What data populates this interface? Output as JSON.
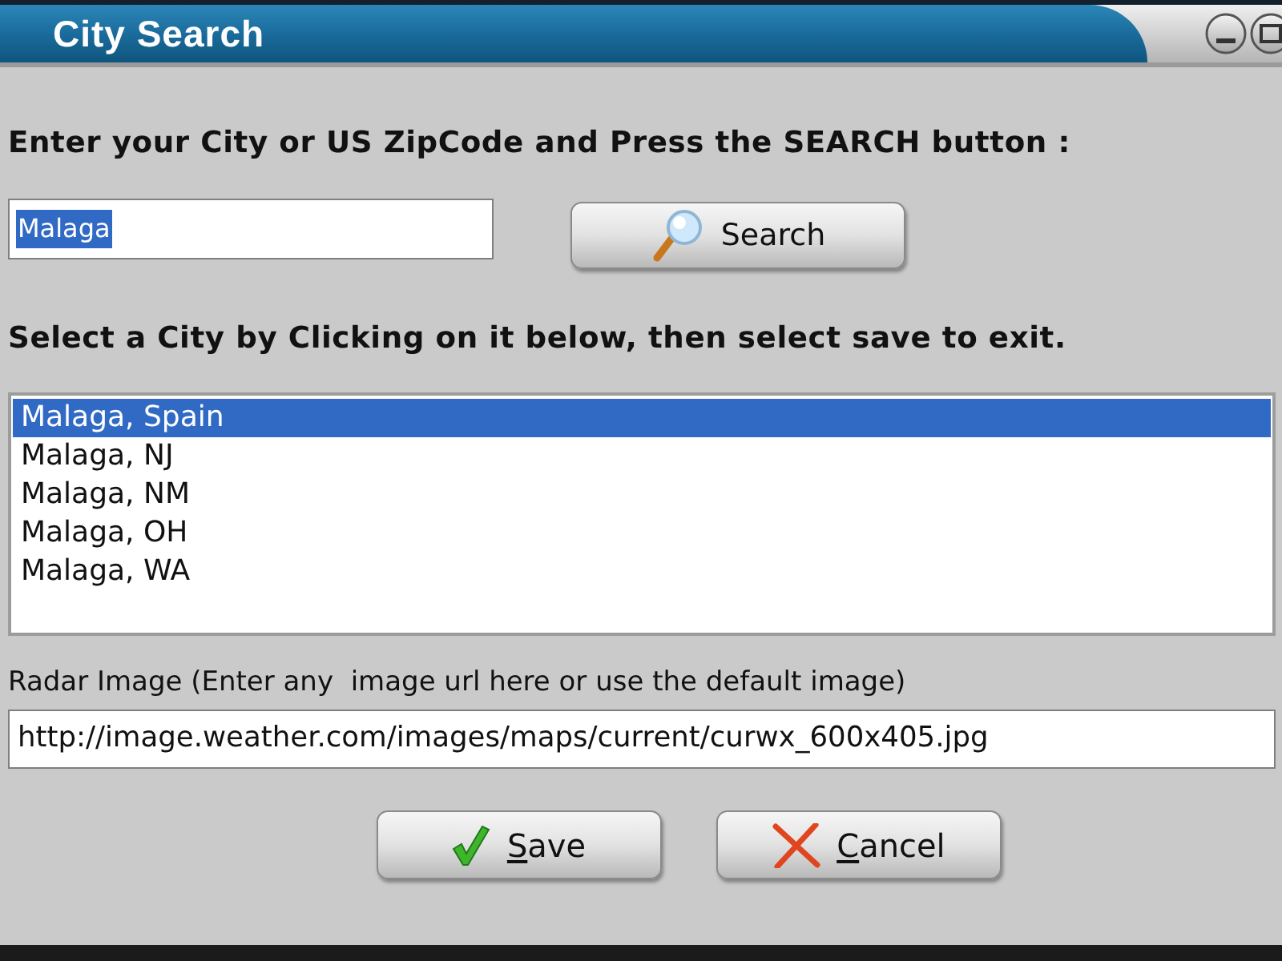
{
  "window": {
    "title": "City Search",
    "controls": [
      {
        "kind": "minimize"
      },
      {
        "kind": "maximize"
      }
    ]
  },
  "search": {
    "prompt": "Enter your City or US ZipCode and Press the SEARCH button :",
    "value": "Malaga",
    "value_selected": true,
    "button": {
      "label": "Search"
    }
  },
  "results": {
    "prompt": "Select a City by Clicking on it below, then select save to exit.",
    "items": [
      {
        "label": "Malaga, Spain",
        "selected": true
      },
      {
        "label": "Malaga, NJ",
        "selected": false
      },
      {
        "label": "Malaga, NM",
        "selected": false
      },
      {
        "label": "Malaga, OH",
        "selected": false
      },
      {
        "label": "Malaga, WA",
        "selected": false
      }
    ]
  },
  "radar": {
    "label": "Radar Image (Enter any  image url here or use the default image)",
    "value": "http://image.weather.com/images/maps/current/curwx_600x405.jpg"
  },
  "buttons": [
    {
      "kind": "save",
      "label": "Save",
      "mnemonic_underlined": true
    },
    {
      "kind": "cancel",
      "label": "Cancel",
      "mnemonic_underlined": true
    }
  ]
}
